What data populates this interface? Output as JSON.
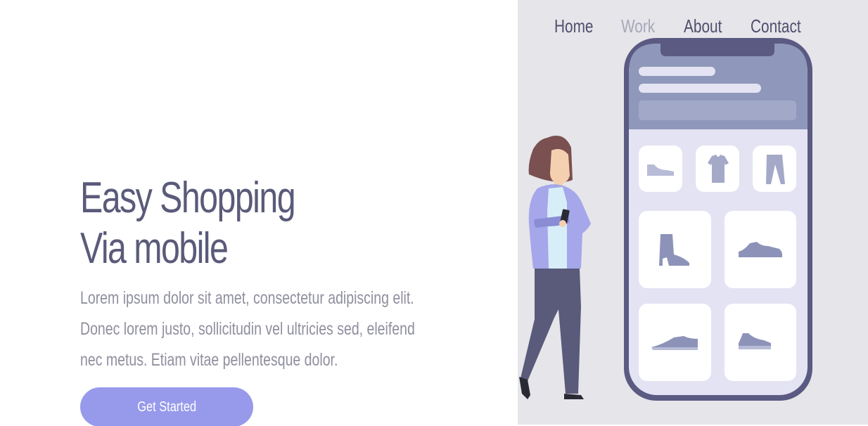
{
  "nav": {
    "items": [
      {
        "label": "Home",
        "active": false
      },
      {
        "label": "Work",
        "active": true
      },
      {
        "label": "About",
        "active": false
      },
      {
        "label": "Contact",
        "active": false
      }
    ]
  },
  "hero": {
    "title_line1": "Easy Shopping",
    "title_line2": "Via mobile",
    "description": "Lorem ipsum dolor sit amet, consectetur adipiscing elit. Donec lorem justo, sollicitudin vel ultricies sed, eleifend nec metus. Etiam vitae pellentesque dolor.",
    "cta_label": "Get Started"
  },
  "colors": {
    "title": "#5a5a7a",
    "body_text": "#8f8f9f",
    "cta": "#979aea",
    "panel_bg": "#e6e5ea",
    "phone_frame": "#5a5a82",
    "nav_active": "#a7a7b9"
  },
  "illustration": {
    "products": [
      "flat-shoe-icon",
      "tshirt-icon",
      "pants-icon",
      "boot-icon",
      "sneaker-icon",
      "loafer-icon",
      "low-shoe-icon"
    ]
  }
}
